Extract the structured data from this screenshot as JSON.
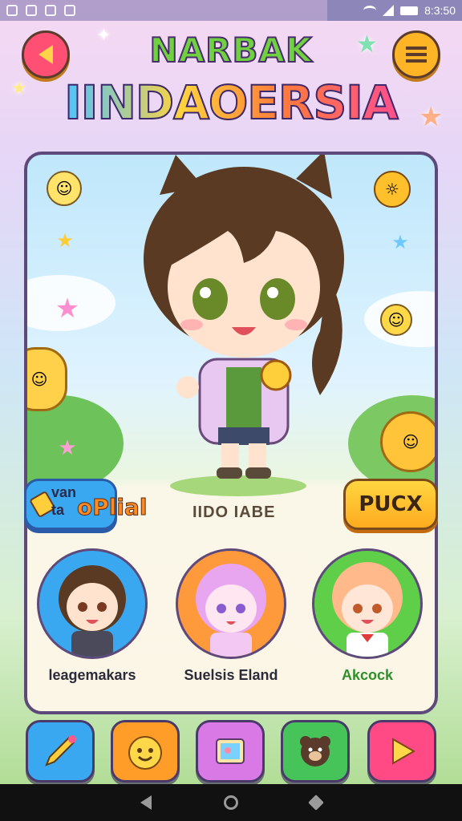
{
  "status_bar": {
    "time": "8:3:50"
  },
  "header": {
    "title_small": "NARBAK",
    "title_big": "IINDAOERSIA"
  },
  "info_row": {
    "name_line1": "van",
    "name_line2": "ta",
    "name_big": "oPlial",
    "id_label": "IIDO IABE",
    "action_label": "PUCX"
  },
  "cards": [
    {
      "name": "leagemakars",
      "ring_color": "#3aa8f0"
    },
    {
      "name": "Suelsis Eland",
      "ring_color": "#ff9a3c"
    },
    {
      "name": "Akcock",
      "ring_color": "#5fcf4a"
    }
  ],
  "toolbar": [
    {
      "icon": "pencil-brush-icon",
      "color": "#3aa8f0"
    },
    {
      "icon": "smiley-face-icon",
      "color": "#ff9d28"
    },
    {
      "icon": "picture-frame-icon",
      "color": "#d879e6"
    },
    {
      "icon": "bear-icon",
      "color": "#46c45a"
    },
    {
      "icon": "play-icon",
      "color": "#ff4a86"
    }
  ]
}
